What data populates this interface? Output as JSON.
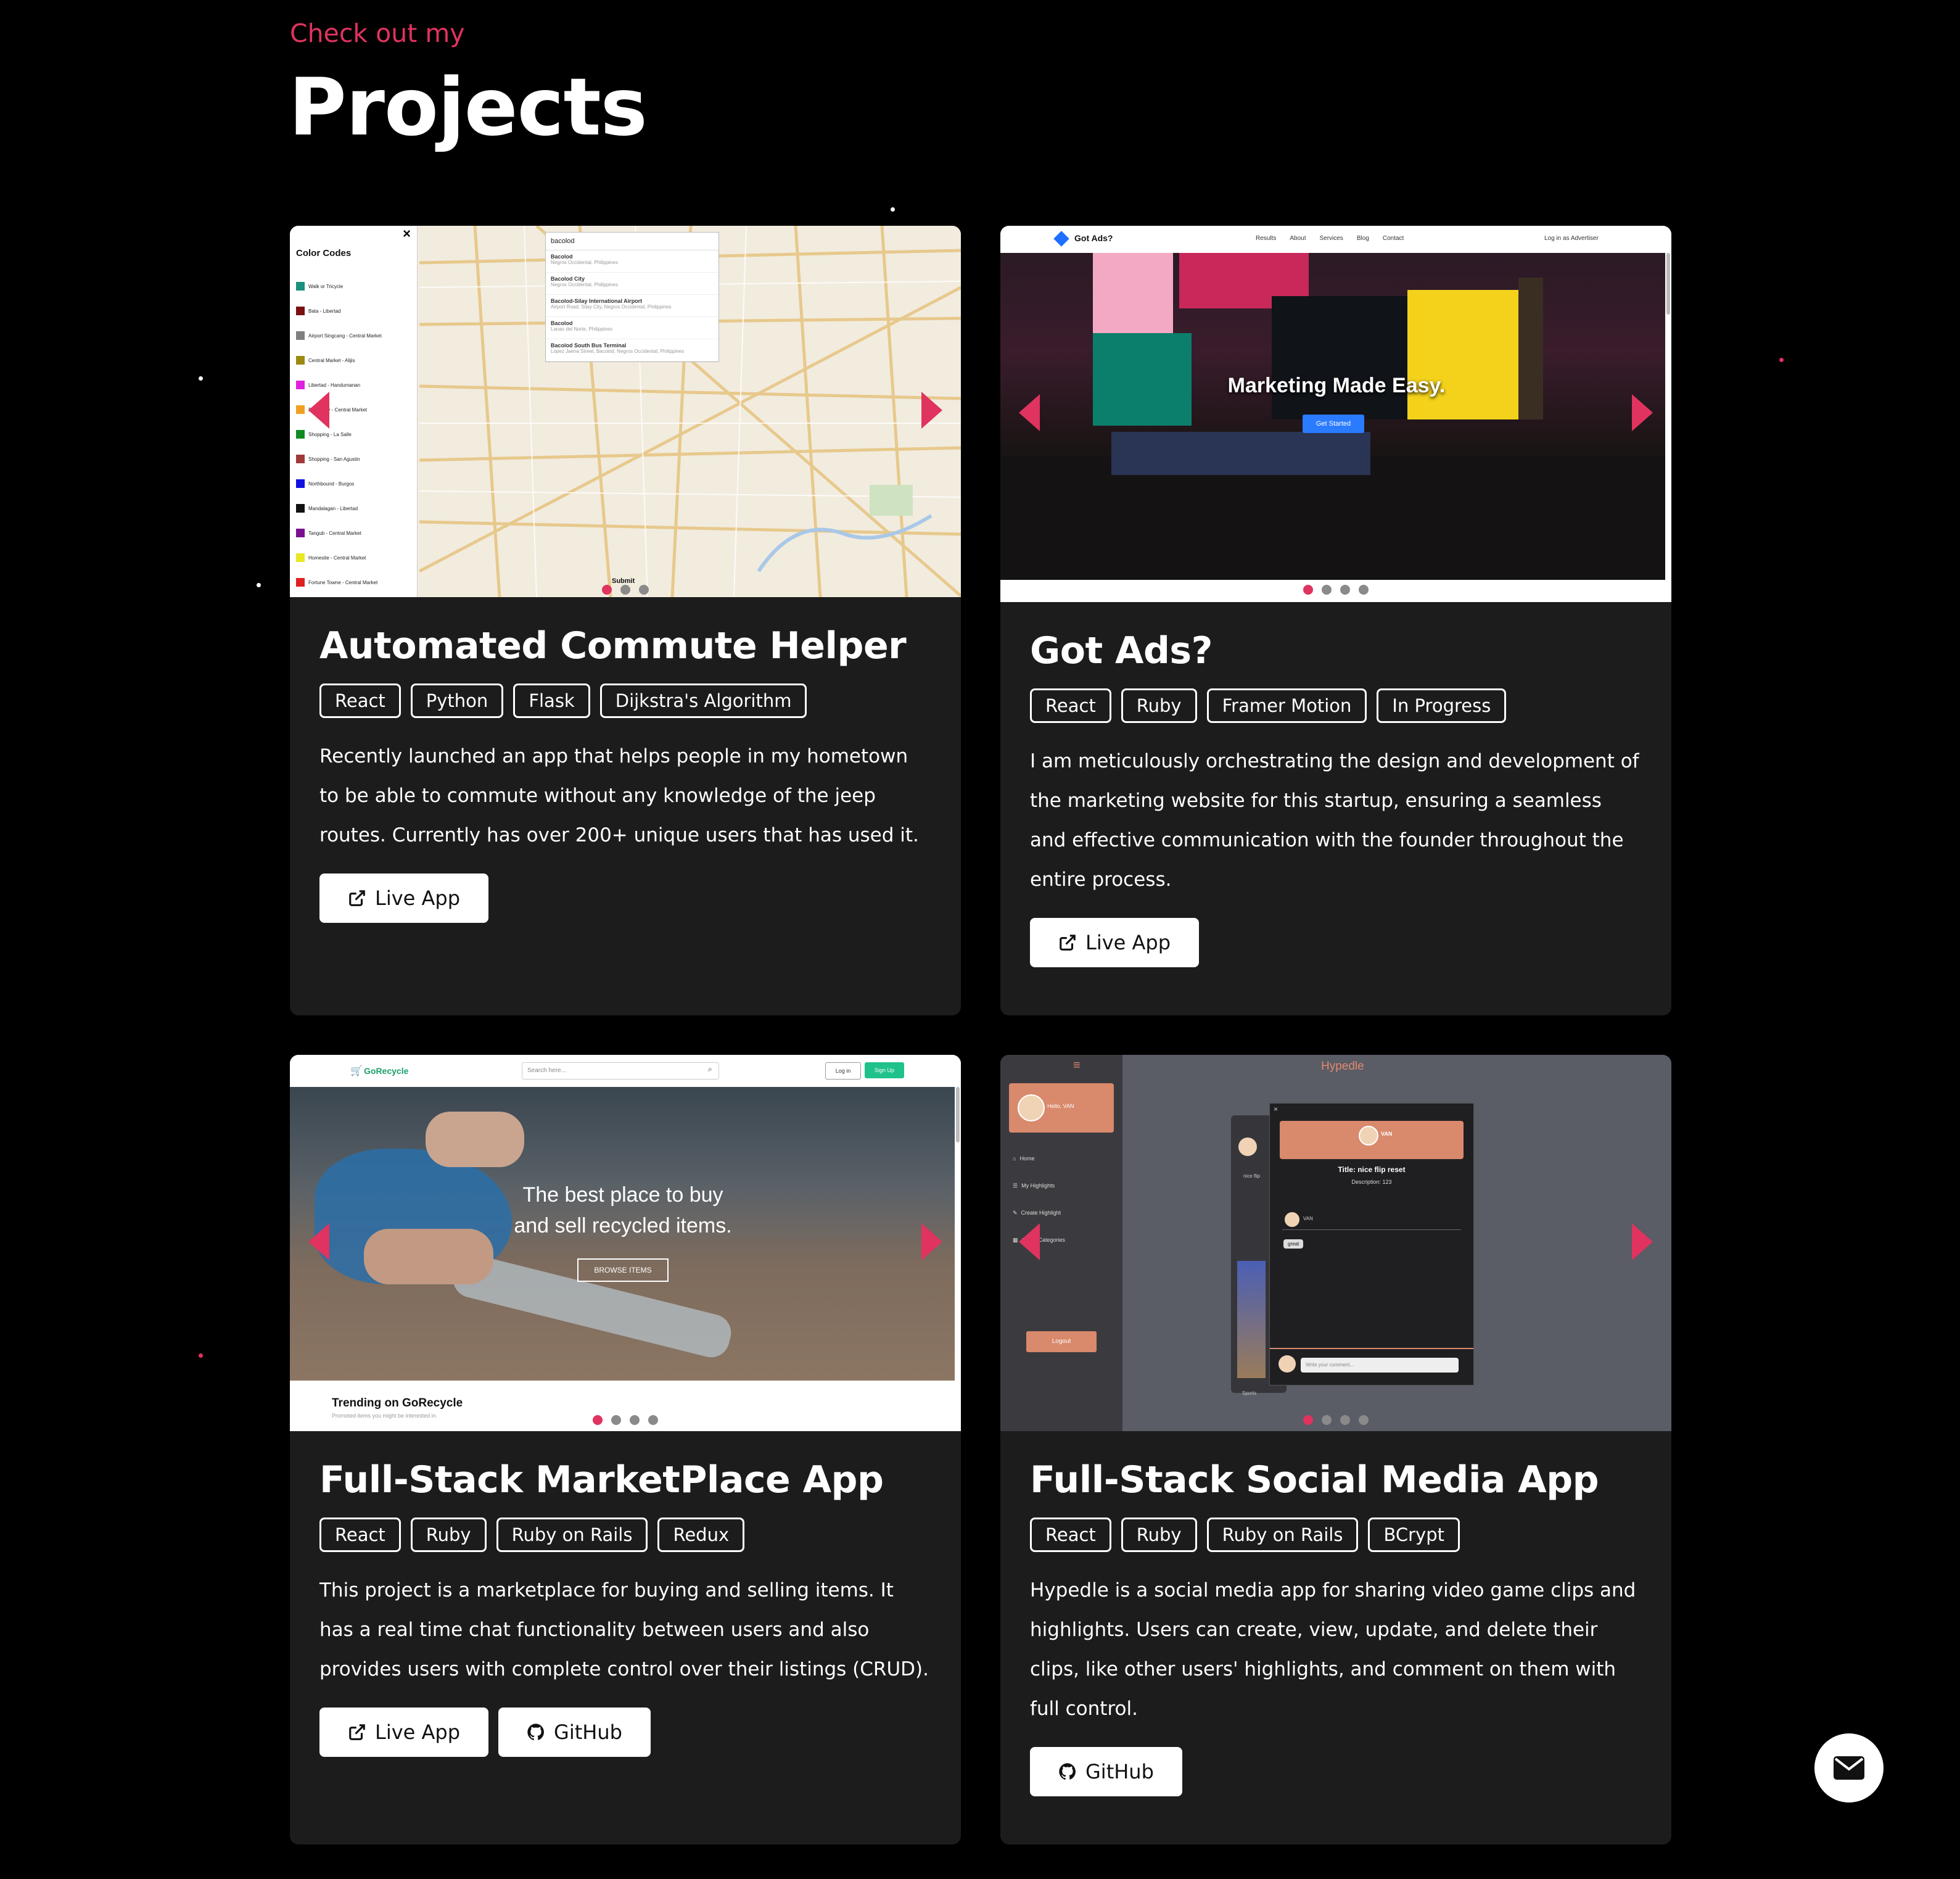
{
  "header": {
    "eyebrow": "Check out my",
    "title": "Projects"
  },
  "colors": {
    "accent": "#e0335f",
    "card_bg": "#1c1c1c",
    "page_bg": "#000000"
  },
  "projects": [
    {
      "title": "Automated Commute Helper",
      "tags": [
        "React",
        "Python",
        "Flask",
        "Dijkstra's Algorithm"
      ],
      "description": "Recently launched an app that helps people in my hometown to be able to commute without any knowledge of the jeep routes. Currently has over 200+ unique users that has used it.",
      "buttons": [
        {
          "label": "Live App",
          "icon": "external-link-icon"
        }
      ],
      "screenshot": {
        "legend_title": "Color Codes",
        "legend": [
          "Walk or Tricycle",
          "Bata - Libertad",
          "Airport Singcang - Central Market",
          "Central Market - Alijis",
          "Libertad - Handumanan",
          "Punta Tay - Central Market",
          "Shopping - La Salle",
          "Shopping - San Agustin",
          "Northbound - Burgos",
          "Mandalagan - Libertad",
          "Tangub - Central Market",
          "Homesite - Central Market",
          "Fortune Towne - Central Market"
        ],
        "search_value": "bacolod",
        "suggestions": [
          {
            "name": "Bacolod",
            "sub": "Negros Occidental, Philippines"
          },
          {
            "name": "Bacolod City",
            "sub": "Negros Occidental, Philippines"
          },
          {
            "name": "Bacolod-Silay International Airport",
            "sub": "Airport Road, Silay City, Negros Occidental, Philippines"
          },
          {
            "name": "Bacolod",
            "sub": "Lanao del Norte, Philippines"
          },
          {
            "name": "Bacolod South Bus Terminal",
            "sub": "Lopez Jaena Street, Bacolod, Negros Occidental, Philippines"
          }
        ],
        "submit": "Submit",
        "close": "×"
      }
    },
    {
      "title": "Got Ads?",
      "tags": [
        "React",
        "Ruby",
        "Framer Motion",
        "In Progress"
      ],
      "description": "I am meticulously orchestrating the design and development of the marketing website for this startup, ensuring a seamless and effective communication with the founder throughout the entire process.",
      "buttons": [
        {
          "label": "Live App",
          "icon": "external-link-icon"
        }
      ],
      "screenshot": {
        "brand": "Got Ads?",
        "nav": [
          "Results",
          "About",
          "Services",
          "Blog",
          "Contact"
        ],
        "login": "Log in as Advertiser",
        "hero": "Marketing Made Easy.",
        "cta": "Get Started"
      }
    },
    {
      "title": "Full-Stack MarketPlace App",
      "tags": [
        "React",
        "Ruby",
        "Ruby on Rails",
        "Redux"
      ],
      "description": "This project is a marketplace for buying and selling items. It has a real time chat functionality between users and also provides users with complete control over their listings (CRUD).",
      "buttons": [
        {
          "label": "Live App",
          "icon": "external-link-icon"
        },
        {
          "label": "GitHub",
          "icon": "github-icon"
        }
      ],
      "screenshot": {
        "brand": "GoRecycle",
        "search_placeholder": "Search here...",
        "login": "Log in",
        "signup": "Sign Up",
        "hero_line1": "The best place to buy",
        "hero_line2": "and sell recycled items.",
        "cta": "BROWSE ITEMS",
        "trending": "Trending on GoRecycle",
        "trending_sub": "Promoted items you might be interested in."
      }
    },
    {
      "title": "Full-Stack Social Media App",
      "tags": [
        "React",
        "Ruby",
        "Ruby on Rails",
        "BCrypt"
      ],
      "description": "Hypedle is a social media app for sharing video game clips and highlights. Users can create, view, update, and delete their clips, like other users' highlights, and comment on them with full control.",
      "buttons": [
        {
          "label": "GitHub",
          "icon": "github-icon"
        }
      ],
      "screenshot": {
        "brand": "Hypedle",
        "hello": "Hello, VAN",
        "menu": [
          "Home",
          "My Highlights",
          "Create Highlight",
          "Game Categories"
        ],
        "logout": "Logout",
        "user": "VAN",
        "post_title": "Title: nice flip reset",
        "post_desc": "Description: 123",
        "comment": "great",
        "comment_placeholder": "Write your comment...",
        "side_label": "nice flip",
        "sports": "Sports"
      }
    }
  ]
}
